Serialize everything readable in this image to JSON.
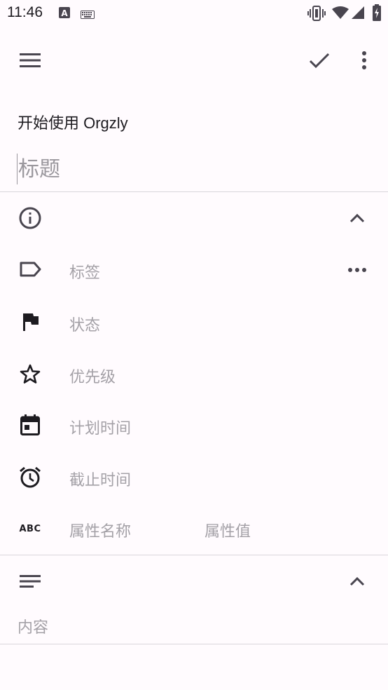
{
  "status_bar": {
    "time": "11:46",
    "icons": [
      "font-a-icon",
      "keyboard-icon",
      "vibrate-icon",
      "wifi-icon",
      "signal-icon",
      "battery-charging-icon"
    ]
  },
  "toolbar": {
    "menu_icon": "menu-icon",
    "save_icon": "check-icon",
    "overflow_icon": "more-vert-icon"
  },
  "note": {
    "book_name": "开始使用 Orgzly",
    "title_placeholder": "标题",
    "title_value": ""
  },
  "metadata_section": {
    "icon": "info-icon",
    "expanded_icon": "chevron-up-icon",
    "fields": {
      "tags": {
        "icon": "label-icon",
        "label": "标签",
        "action_icon": "more-horiz-icon"
      },
      "state": {
        "icon": "flag-icon",
        "label": "状态"
      },
      "priority": {
        "icon": "star-outline-icon",
        "label": "优先级"
      },
      "scheduled": {
        "icon": "calendar-icon",
        "label": "计划时间"
      },
      "deadline": {
        "icon": "alarm-icon",
        "label": "截止时间"
      },
      "property": {
        "icon": "abc-icon",
        "icon_text": "ABC",
        "name_placeholder": "属性名称",
        "value_placeholder": "属性值"
      }
    }
  },
  "content_section": {
    "icon": "notes-icon",
    "expanded_icon": "chevron-up-icon",
    "placeholder": "内容"
  },
  "colors": {
    "background": "#fffbfe",
    "icon": "#49454f",
    "hint_text": "#a4a1a7",
    "divider": "#d9d6db"
  }
}
